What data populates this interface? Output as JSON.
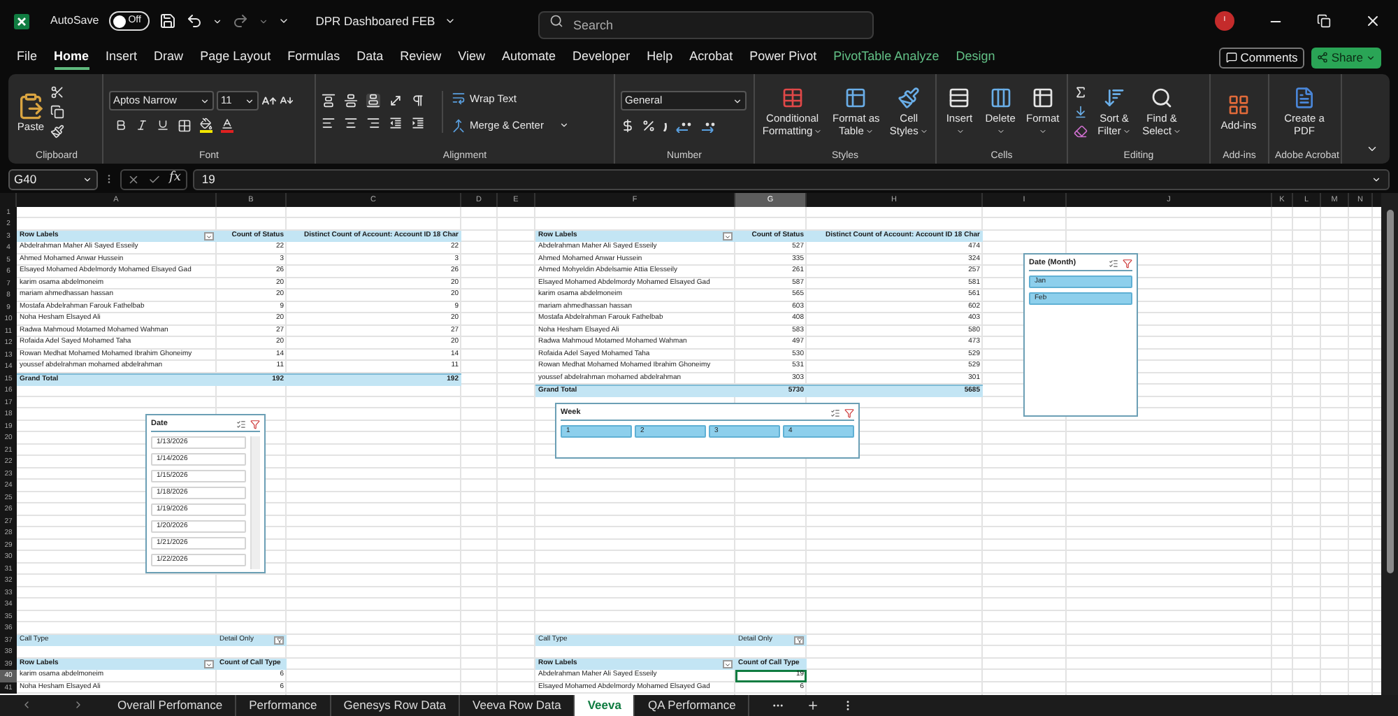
{
  "title_bar": {
    "autosave_label": "AutoSave",
    "autosave": {
      "on": false,
      "label": "Off"
    },
    "document_title": "DPR Dashboared FEB",
    "search": {
      "placeholder": "Search"
    },
    "account_initial": "I"
  },
  "menu_tabs": [
    {
      "label": "File",
      "selected": false,
      "contextual": false
    },
    {
      "label": "Home",
      "selected": true,
      "contextual": false
    },
    {
      "label": "Insert",
      "selected": false,
      "contextual": false
    },
    {
      "label": "Draw",
      "selected": false,
      "contextual": false
    },
    {
      "label": "Page Layout",
      "selected": false,
      "contextual": false
    },
    {
      "label": "Formulas",
      "selected": false,
      "contextual": false
    },
    {
      "label": "Data",
      "selected": false,
      "contextual": false
    },
    {
      "label": "Review",
      "selected": false,
      "contextual": false
    },
    {
      "label": "View",
      "selected": false,
      "contextual": false
    },
    {
      "label": "Automate",
      "selected": false,
      "contextual": false
    },
    {
      "label": "Developer",
      "selected": false,
      "contextual": false
    },
    {
      "label": "Help",
      "selected": false,
      "contextual": false
    },
    {
      "label": "Acrobat",
      "selected": false,
      "contextual": false
    },
    {
      "label": "Power Pivot",
      "selected": false,
      "contextual": false
    },
    {
      "label": "PivotTable Analyze",
      "selected": false,
      "contextual": true
    },
    {
      "label": "Design",
      "selected": false,
      "contextual": true
    }
  ],
  "header_buttons": {
    "comments": "Comments",
    "share": "Share"
  },
  "ribbon": {
    "clipboard": {
      "paste": "Paste",
      "label": "Clipboard"
    },
    "font": {
      "name": "Aptos Narrow",
      "size": "11",
      "label": "Font"
    },
    "alignment": {
      "wrap": "Wrap Text",
      "merge": "Merge & Center",
      "label": "Alignment"
    },
    "number": {
      "format": "General",
      "label": "Number"
    },
    "styles": {
      "buttons": [
        "Conditional Formatting",
        "Format as Table",
        "Cell Styles"
      ],
      "label": "Styles"
    },
    "cells": {
      "buttons": [
        "Insert",
        "Delete",
        "Format"
      ],
      "label": "Cells"
    },
    "editing": {
      "buttons": [
        "Sort & Filter",
        "Find & Select"
      ],
      "label": "Editing"
    },
    "addins": {
      "button": "Add-ins",
      "label": "Add-ins"
    },
    "acrobat": {
      "button": "Create a PDF",
      "label": "Adobe Acrobat"
    }
  },
  "formula_bar": {
    "name_box": "G40",
    "function_label": "fx",
    "value": "19"
  },
  "columns": [
    {
      "label": "A",
      "selected": false
    },
    {
      "label": "B",
      "selected": false
    },
    {
      "label": "C",
      "selected": false
    },
    {
      "label": "D",
      "selected": false
    },
    {
      "label": "E",
      "selected": false
    },
    {
      "label": "F",
      "selected": false
    },
    {
      "label": "G",
      "selected": true
    },
    {
      "label": "H",
      "selected": false
    },
    {
      "label": "I",
      "selected": false
    },
    {
      "label": "J",
      "selected": false
    },
    {
      "label": "K",
      "selected": false
    },
    {
      "label": "L",
      "selected": false
    },
    {
      "label": "M",
      "selected": false
    },
    {
      "label": "N",
      "selected": false
    }
  ],
  "rows": [
    {
      "label": "1",
      "selected": false
    },
    {
      "label": "2",
      "selected": false
    },
    {
      "label": "3",
      "selected": false
    },
    {
      "label": "4",
      "selected": false
    },
    {
      "label": "5",
      "selected": false
    },
    {
      "label": "6",
      "selected": false
    },
    {
      "label": "7",
      "selected": false
    },
    {
      "label": "8",
      "selected": false
    },
    {
      "label": "9",
      "selected": false
    },
    {
      "label": "10",
      "selected": false
    },
    {
      "label": "11",
      "selected": false
    },
    {
      "label": "12",
      "selected": false
    },
    {
      "label": "13",
      "selected": false
    },
    {
      "label": "14",
      "selected": false
    },
    {
      "label": "15",
      "selected": false
    },
    {
      "label": "16",
      "selected": false
    },
    {
      "label": "17",
      "selected": false
    },
    {
      "label": "18",
      "selected": false
    },
    {
      "label": "19",
      "selected": false
    },
    {
      "label": "20",
      "selected": false
    },
    {
      "label": "21",
      "selected": false
    },
    {
      "label": "22",
      "selected": false
    },
    {
      "label": "23",
      "selected": false
    },
    {
      "label": "24",
      "selected": false
    },
    {
      "label": "25",
      "selected": false
    },
    {
      "label": "26",
      "selected": false
    },
    {
      "label": "27",
      "selected": false
    },
    {
      "label": "28",
      "selected": false
    },
    {
      "label": "29",
      "selected": false
    },
    {
      "label": "30",
      "selected": false
    },
    {
      "label": "31",
      "selected": false
    },
    {
      "label": "32",
      "selected": false
    },
    {
      "label": "33",
      "selected": false
    },
    {
      "label": "34",
      "selected": false
    },
    {
      "label": "35",
      "selected": false
    },
    {
      "label": "36",
      "selected": false
    },
    {
      "label": "37",
      "selected": false
    },
    {
      "label": "38",
      "selected": false
    },
    {
      "label": "39",
      "selected": false
    },
    {
      "label": "40",
      "selected": true
    },
    {
      "label": "41",
      "selected": false
    }
  ],
  "pivots": [
    {
      "columns": [
        "Row Labels",
        "Count of Status",
        "Distinct Count of Account: Account ID 18 Char"
      ],
      "rows": [
        [
          "Abdelrahman Maher Ali Sayed Esseily",
          "22",
          "22"
        ],
        [
          "Ahmed Mohamed Anwar Hussein",
          "3",
          "3"
        ],
        [
          "Elsayed Mohamed Abdelmordy Mohamed Elsayed Gad",
          "26",
          "26"
        ],
        [
          "karim osama abdelmoneim",
          "20",
          "20"
        ],
        [
          "mariam ahmedhassan hassan",
          "20",
          "20"
        ],
        [
          "Mostafa Abdelrahman Farouk Fathelbab",
          "9",
          "9"
        ],
        [
          "Noha Hesham Elsayed Ali",
          "20",
          "20"
        ],
        [
          "Radwa Mahmoud Motamed Mohamed Wahman",
          "27",
          "27"
        ],
        [
          "Rofaida Adel Sayed Mohamed Taha",
          "20",
          "20"
        ],
        [
          "Rowan Medhat Mohamed Mohamed Ibrahim Ghoneimy",
          "14",
          "14"
        ],
        [
          "youssef abdelrahman mohamed abdelrahman",
          "11",
          "11"
        ]
      ],
      "total": [
        "Grand Total",
        "192",
        "192"
      ]
    },
    {
      "columns": [
        "Row Labels",
        "Count of Status",
        "Distinct Count of Account: Account ID 18 Char"
      ],
      "rows": [
        [
          "Abdelrahman Maher Ali Sayed Esseily",
          "527",
          "474"
        ],
        [
          "Ahmed Mohamed Anwar Hussein",
          "335",
          "324"
        ],
        [
          "Ahmed Mohyeldin Abdelsamie Attia Elesseily",
          "261",
          "257"
        ],
        [
          "Elsayed Mohamed Abdelmordy Mohamed Elsayed Gad",
          "587",
          "581"
        ],
        [
          "karim osama abdelmoneim",
          "565",
          "561"
        ],
        [
          "mariam ahmedhassan hassan",
          "603",
          "602"
        ],
        [
          "Mostafa Abdelrahman Farouk Fathelbab",
          "408",
          "403"
        ],
        [
          "Noha Hesham Elsayed Ali",
          "583",
          "580"
        ],
        [
          "Radwa Mahmoud Motamed Mohamed Wahman",
          "497",
          "473"
        ],
        [
          "Rofaida Adel Sayed Mohamed Taha",
          "530",
          "529"
        ],
        [
          "Rowan Medhat Mohamed Mohamed Ibrahim Ghoneimy",
          "531",
          "529"
        ],
        [
          "youssef abdelrahman mohamed abdelrahman",
          "303",
          "301"
        ]
      ],
      "total": [
        "Grand Total",
        "5730",
        "5685"
      ]
    }
  ],
  "call_type_pivots": [
    {
      "filter": [
        "Call Type",
        "Detail Only"
      ],
      "columns": [
        "Row Labels",
        "Count of Call Type"
      ],
      "rows": [
        {
          "label": "karim osama abdelmoneim",
          "value": "6",
          "active": false
        },
        {
          "label": "Noha Hesham Elsayed Ali",
          "value": "6",
          "active": false
        }
      ]
    },
    {
      "filter": [
        "Call Type",
        "Detail Only"
      ],
      "columns": [
        "Row Labels",
        "Count of Call Type"
      ],
      "rows": [
        {
          "label": "Abdelrahman Maher Ali Sayed Esseily",
          "value": "19",
          "active": true
        },
        {
          "label": "Elsayed Mohamed Abdelmordy Mohamed Elsayed Gad",
          "value": "6",
          "active": false
        }
      ]
    }
  ],
  "slicers": [
    {
      "title": "Date",
      "items": [
        {
          "label": "1/13/2026",
          "selected": false
        },
        {
          "label": "1/14/2026",
          "selected": false
        },
        {
          "label": "1/15/2026",
          "selected": false
        },
        {
          "label": "1/18/2026",
          "selected": false
        },
        {
          "label": "1/19/2026",
          "selected": false
        },
        {
          "label": "1/20/2026",
          "selected": false
        },
        {
          "label": "1/21/2026",
          "selected": false
        },
        {
          "label": "1/22/2026",
          "selected": false
        }
      ]
    },
    {
      "title": "Week",
      "items": [
        {
          "label": "1",
          "selected": true
        },
        {
          "label": "2",
          "selected": true
        },
        {
          "label": "3",
          "selected": true
        },
        {
          "label": "4",
          "selected": true
        }
      ]
    },
    {
      "title": "Date (Month)",
      "items": [
        {
          "label": "Jan",
          "selected": true
        },
        {
          "label": "Feb",
          "selected": true
        }
      ]
    }
  ],
  "sheet_tabs": [
    {
      "label": "Overall Perfomance",
      "selected": false
    },
    {
      "label": "Performance",
      "selected": false
    },
    {
      "label": "Genesys Row Data",
      "selected": false
    },
    {
      "label": "Veeva Row Data",
      "selected": false
    },
    {
      "label": "Veeva",
      "selected": true
    },
    {
      "label": "QA Performance",
      "selected": false
    }
  ]
}
